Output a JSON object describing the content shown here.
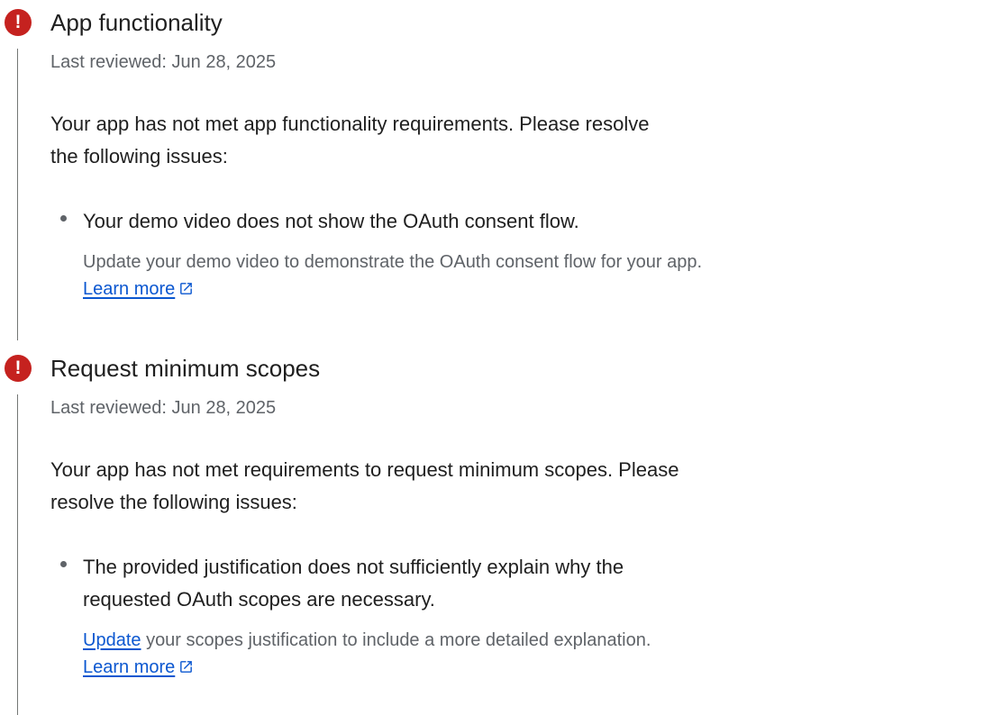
{
  "sections": [
    {
      "icon": "error-icon",
      "icon_glyph": "!",
      "title": "App functionality",
      "last_reviewed": "Last reviewed: Jun 28, 2025",
      "description": "Your app has not met app functionality requirements. Please resolve the following issues:",
      "issues": [
        {
          "title": "Your demo video does not show the OAuth consent flow.",
          "help_text": "Update your demo video to demonstrate the OAuth consent flow for your app.",
          "learn_more": "Learn more"
        }
      ]
    },
    {
      "icon": "error-icon",
      "icon_glyph": "!",
      "title": "Request minimum scopes",
      "last_reviewed": "Last reviewed: Jun 28, 2025",
      "description": "Your app has not met requirements to request minimum scopes. Please resolve the following issues:",
      "issues": [
        {
          "title": "The provided justification does not sufficiently explain why the requested OAuth scopes are necessary.",
          "update_link": "Update",
          "help_text": "your scopes justification to include a more detailed explanation.",
          "learn_more": "Learn more"
        }
      ]
    }
  ],
  "colors": {
    "error": "#c5221f",
    "link": "#0b57d0",
    "secondary_text": "#5f6368",
    "primary_text": "#1f1f1f"
  }
}
